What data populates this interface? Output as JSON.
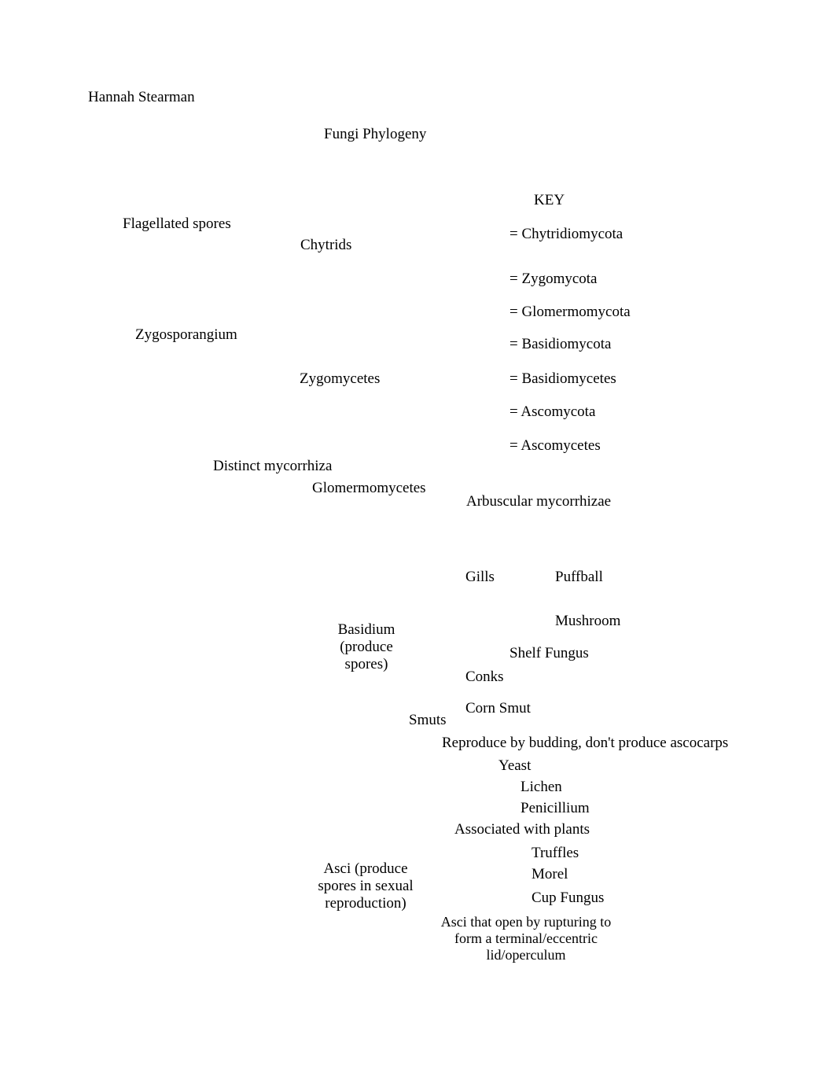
{
  "author": "Hannah Stearman",
  "title": "Fungi Phylogeny",
  "key": {
    "heading": "KEY",
    "items": [
      "= Chytridiomycota",
      "= Zygomycota",
      "= Glomermomycota",
      "= Basidiomycota",
      "= Basidiomycetes",
      "= Ascomycota",
      "= Ascomycetes"
    ]
  },
  "nodes": {
    "flagellated_spores": "Flagellated spores",
    "chytrids": "Chytrids",
    "zygosporangium": "Zygosporangium",
    "zygomycetes": "Zygomycetes",
    "distinct_mycorrhiza": "Distinct mycorrhiza",
    "glomermomycetes": "Glomermomycetes",
    "arbuscular_mycorrhizae": "Arbuscular mycorrhizae",
    "gills": "Gills",
    "puffball": "Puffball",
    "mushroom": "Mushroom",
    "basidium": "Basidium (produce spores)",
    "shelf_fungus": "Shelf Fungus",
    "conks": "Conks",
    "corn_smut": "Corn Smut",
    "smuts": "Smuts",
    "budding_note": "Reproduce by budding, don't produce ascocarps",
    "yeast": "Yeast",
    "lichen": "Lichen",
    "penicillium": "Penicillium",
    "associated_with_plants": "Associated with plants",
    "truffles": "Truffles",
    "morel": "Morel",
    "cup_fungus": "Cup Fungus",
    "asci": "Asci (produce spores in sexual reproduction)",
    "asci_note": "Asci that open by rupturing to form a terminal/eccentric lid/operculum"
  }
}
